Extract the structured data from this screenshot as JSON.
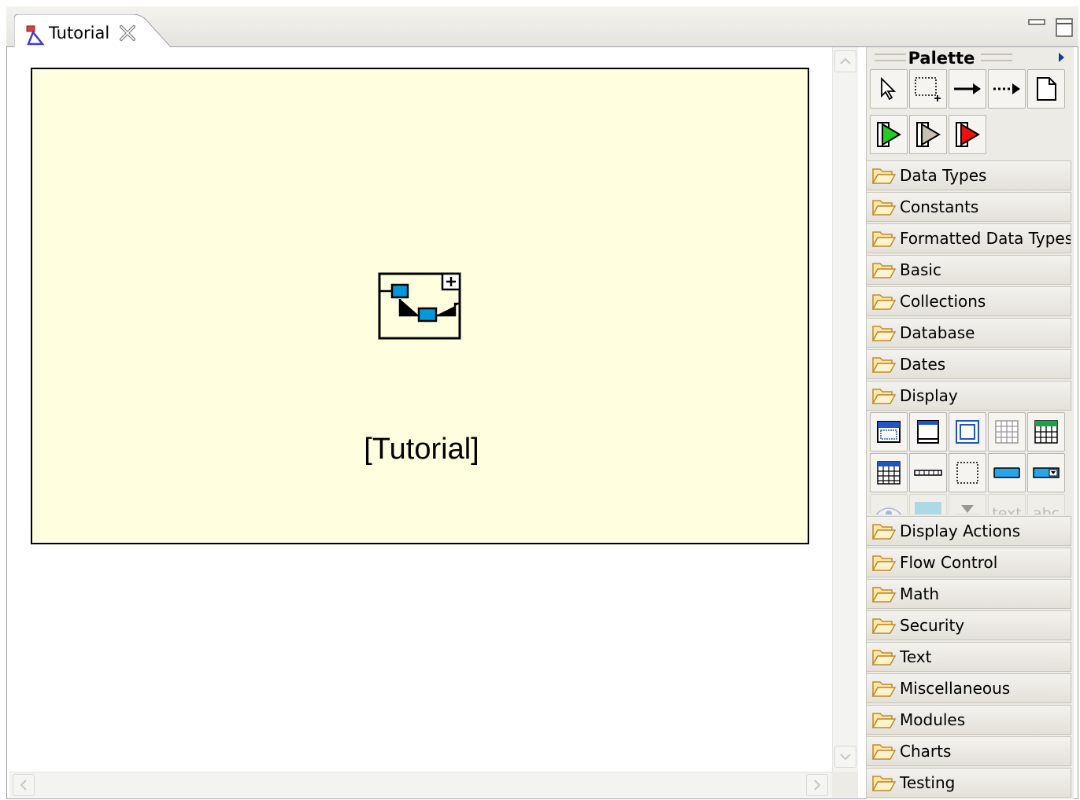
{
  "editor": {
    "tab_title": "Tutorial",
    "tab_icon": "class-diagram-icon",
    "close_icon": "close-icon",
    "minimize_icon": "minimize-icon",
    "maximize_icon": "maximize-icon"
  },
  "diagram": {
    "node_label": "[Tutorial]",
    "node_icon": "module-diagram-icon",
    "node_fill": "#ffffe0",
    "accent_blue": "#0099d9"
  },
  "palette": {
    "title": "Palette",
    "tools_row1": [
      "select-arrow-icon",
      "marquee-select-icon",
      "solid-connection-icon",
      "dotted-connection-icon",
      "note-icon"
    ],
    "tools_row2": [
      "start-green-icon",
      "step-gray-icon",
      "stop-red-icon"
    ],
    "drawers_top": [
      "Data Types",
      "Constants",
      "Formatted Data Types",
      "Basic",
      "Collections",
      "Database",
      "Dates",
      "Display"
    ],
    "display_tools_row1": [
      "window-icon",
      "frame-icon",
      "panel-icon",
      "grid-icon",
      "table-icon"
    ],
    "display_tools_row2": [
      "table-grid-icon",
      "separator-icon",
      "dotted-box-icon",
      "button-icon",
      "dropdown-icon"
    ],
    "display_tools_row3": [
      "eye-icon",
      "image-icon",
      "label-dropdown-icon",
      "text",
      "abc"
    ],
    "drawers_bottom": [
      "Display Actions",
      "Flow Control",
      "Math",
      "Security",
      "Text",
      "Miscellaneous",
      "Modules",
      "Charts",
      "Testing"
    ]
  }
}
